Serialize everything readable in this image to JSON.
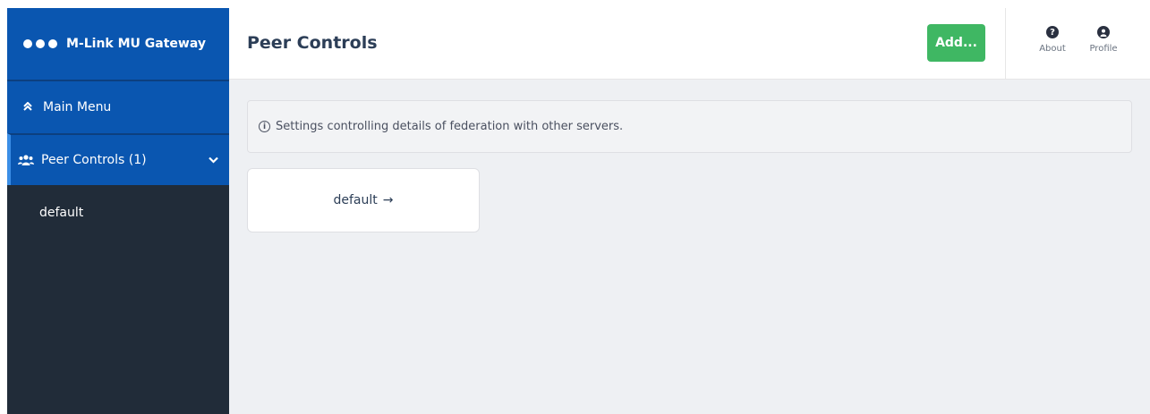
{
  "app": {
    "title": "M-Link MU Gateway"
  },
  "sidebar": {
    "main_menu_label": "Main Menu",
    "peer_controls_label": "Peer Controls (1)",
    "items": [
      {
        "label": "default"
      }
    ]
  },
  "header": {
    "title": "Peer Controls",
    "add_label": "Add...",
    "about_label": "About",
    "profile_label": "Profile"
  },
  "main": {
    "info_text": "Settings controlling details of federation with other servers.",
    "cards": [
      {
        "label": "default",
        "arrow": "→"
      }
    ]
  },
  "colors": {
    "brand_blue": "#0a56b0",
    "sidebar_dark": "#212c39",
    "add_green": "#3fb763"
  },
  "icons": {
    "brand": "dots-icon",
    "main_menu": "chevron-up-double-icon",
    "peer_controls": "users-icon",
    "expand": "chevron-down-icon",
    "about": "question-circle-icon",
    "profile": "user-circle-icon",
    "info": "info-circle-icon"
  }
}
